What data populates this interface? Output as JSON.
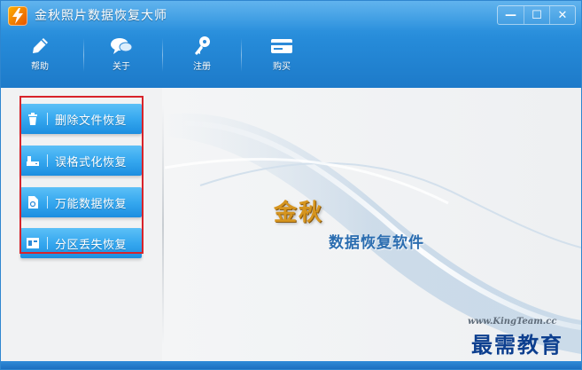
{
  "window": {
    "title": "金秋照片数据恢复大师",
    "controls": {
      "minimize": "—",
      "maximize": "☐",
      "close": "✕"
    }
  },
  "toolbar": {
    "items": [
      {
        "label": "帮助",
        "icon": "pen-icon"
      },
      {
        "label": "关于",
        "icon": "chat-bubble-icon"
      },
      {
        "label": "注册",
        "icon": "key-icon"
      },
      {
        "label": "购买",
        "icon": "card-icon"
      }
    ]
  },
  "menu": {
    "items": [
      {
        "label": "删除文件恢复",
        "icon": "trash-icon"
      },
      {
        "label": "误格式化恢复",
        "icon": "drive-icon"
      },
      {
        "label": "万能数据恢复",
        "icon": "document-icon"
      },
      {
        "label": "分区丢失恢复",
        "icon": "partition-icon"
      }
    ],
    "highlight_color": "#d8232a"
  },
  "banner": {
    "brand_main": "金秋",
    "brand_sub": "数据恢复软件",
    "website": "www.KingTeam.cc"
  },
  "watermark": "最需教育",
  "colors": {
    "titlebar": "#268bd9",
    "menu_button": "#36a8ef",
    "brand_gold": "#d6951f",
    "brand_blue": "#2b6db0"
  }
}
